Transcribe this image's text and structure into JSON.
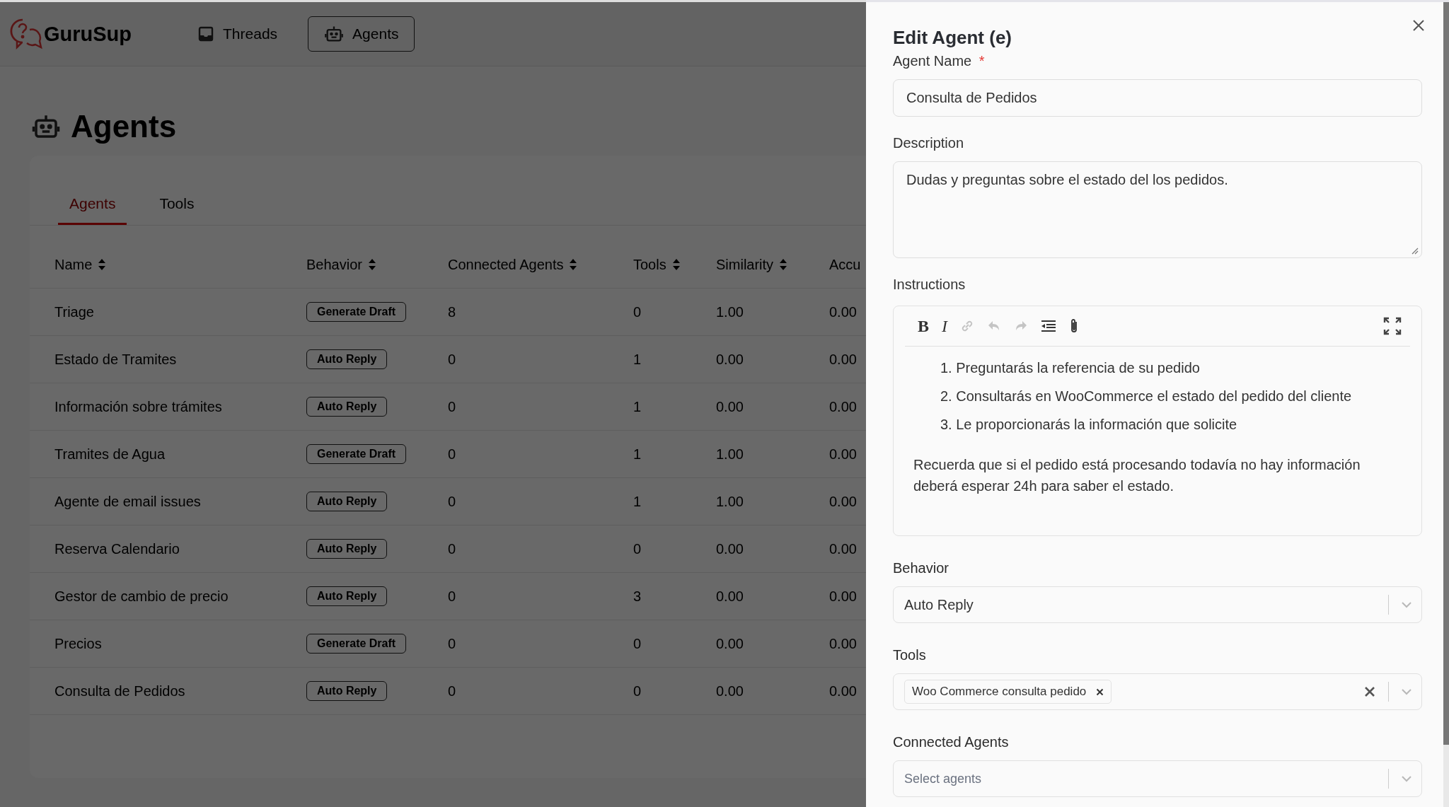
{
  "app": {
    "logo_text": "GuruSup",
    "nav": [
      {
        "label": "Threads",
        "selected": false
      },
      {
        "label": "Agents",
        "selected": true
      }
    ]
  },
  "page": {
    "title": "Agents",
    "tabs": [
      {
        "label": "Agents",
        "selected": true
      },
      {
        "label": "Tools",
        "selected": false
      }
    ],
    "table": {
      "columns": [
        {
          "label": "Name",
          "sortable": true
        },
        {
          "label": "Behavior",
          "sortable": true
        },
        {
          "label": "Connected Agents",
          "sortable": true
        },
        {
          "label": "Tools",
          "sortable": true
        },
        {
          "label": "Similarity",
          "sortable": true
        },
        {
          "label": "Accu",
          "sortable": false
        }
      ],
      "rows": [
        {
          "name": "Triage",
          "behavior": "Generate Draft",
          "connected_agents": "8",
          "tools": "0",
          "similarity": "1.00",
          "column_6": "0.00"
        },
        {
          "name": "Estado de Tramites",
          "behavior": "Auto Reply",
          "connected_agents": "0",
          "tools": "1",
          "similarity": "0.00",
          "column_6": "0.00"
        },
        {
          "name": "Información sobre trámites",
          "behavior": "Auto Reply",
          "connected_agents": "0",
          "tools": "1",
          "similarity": "0.00",
          "column_6": "0.00"
        },
        {
          "name": "Tramites de Agua",
          "behavior": "Generate Draft",
          "connected_agents": "0",
          "tools": "1",
          "similarity": "1.00",
          "column_6": "0.00"
        },
        {
          "name": "Agente de email issues",
          "behavior": "Auto Reply",
          "connected_agents": "0",
          "tools": "1",
          "similarity": "1.00",
          "column_6": "0.00"
        },
        {
          "name": "Reserva Calendario",
          "behavior": "Auto Reply",
          "connected_agents": "0",
          "tools": "0",
          "similarity": "0.00",
          "column_6": "0.00"
        },
        {
          "name": "Gestor de cambio de precio",
          "behavior": "Auto Reply",
          "connected_agents": "0",
          "tools": "3",
          "similarity": "0.00",
          "column_6": "0.00"
        },
        {
          "name": "Precios",
          "behavior": "Generate Draft",
          "connected_agents": "0",
          "tools": "0",
          "similarity": "0.00",
          "column_6": "0.00"
        },
        {
          "name": "Consulta de Pedidos",
          "behavior": "Auto Reply",
          "connected_agents": "0",
          "tools": "0",
          "similarity": "0.00",
          "column_6": "0.00"
        }
      ]
    }
  },
  "drawer": {
    "title": "Edit Agent (e)",
    "agent_name": {
      "label": "Agent Name",
      "required_mark": "*",
      "value": "Consulta de Pedidos"
    },
    "description": {
      "label": "Description",
      "value": "Dudas y preguntas sobre el estado del los pedidos."
    },
    "instructions": {
      "label": "Instructions",
      "toolbar": [
        {
          "kind": "bold",
          "label": "B",
          "disabled": false
        },
        {
          "kind": "italic",
          "label": "I",
          "disabled": false
        },
        {
          "kind": "link",
          "disabled": true
        },
        {
          "kind": "undo",
          "disabled": true
        },
        {
          "kind": "redo",
          "disabled": true
        },
        {
          "kind": "indent",
          "disabled": false
        },
        {
          "kind": "attach",
          "disabled": false
        }
      ],
      "list": [
        {
          "marker": "1.",
          "text": "Preguntarás la referencia de su pedido"
        },
        {
          "marker": "2.",
          "text": "Consultarás en WooCommerce el estado del pedido del cliente"
        },
        {
          "marker": "3.",
          "text": "Le proporcionarás la información que solicite"
        }
      ],
      "paragraph": "Recuerda que si el pedido está procesando todavía no hay información deberá esperar 24h para saber el estado."
    },
    "behavior": {
      "label": "Behavior",
      "value": "Auto Reply"
    },
    "tools": {
      "label": "Tools",
      "tags": [
        "Woo Commerce consulta pedido"
      ]
    },
    "connected_agents": {
      "label": "Connected Agents",
      "placeholder": "Select agents"
    }
  }
}
